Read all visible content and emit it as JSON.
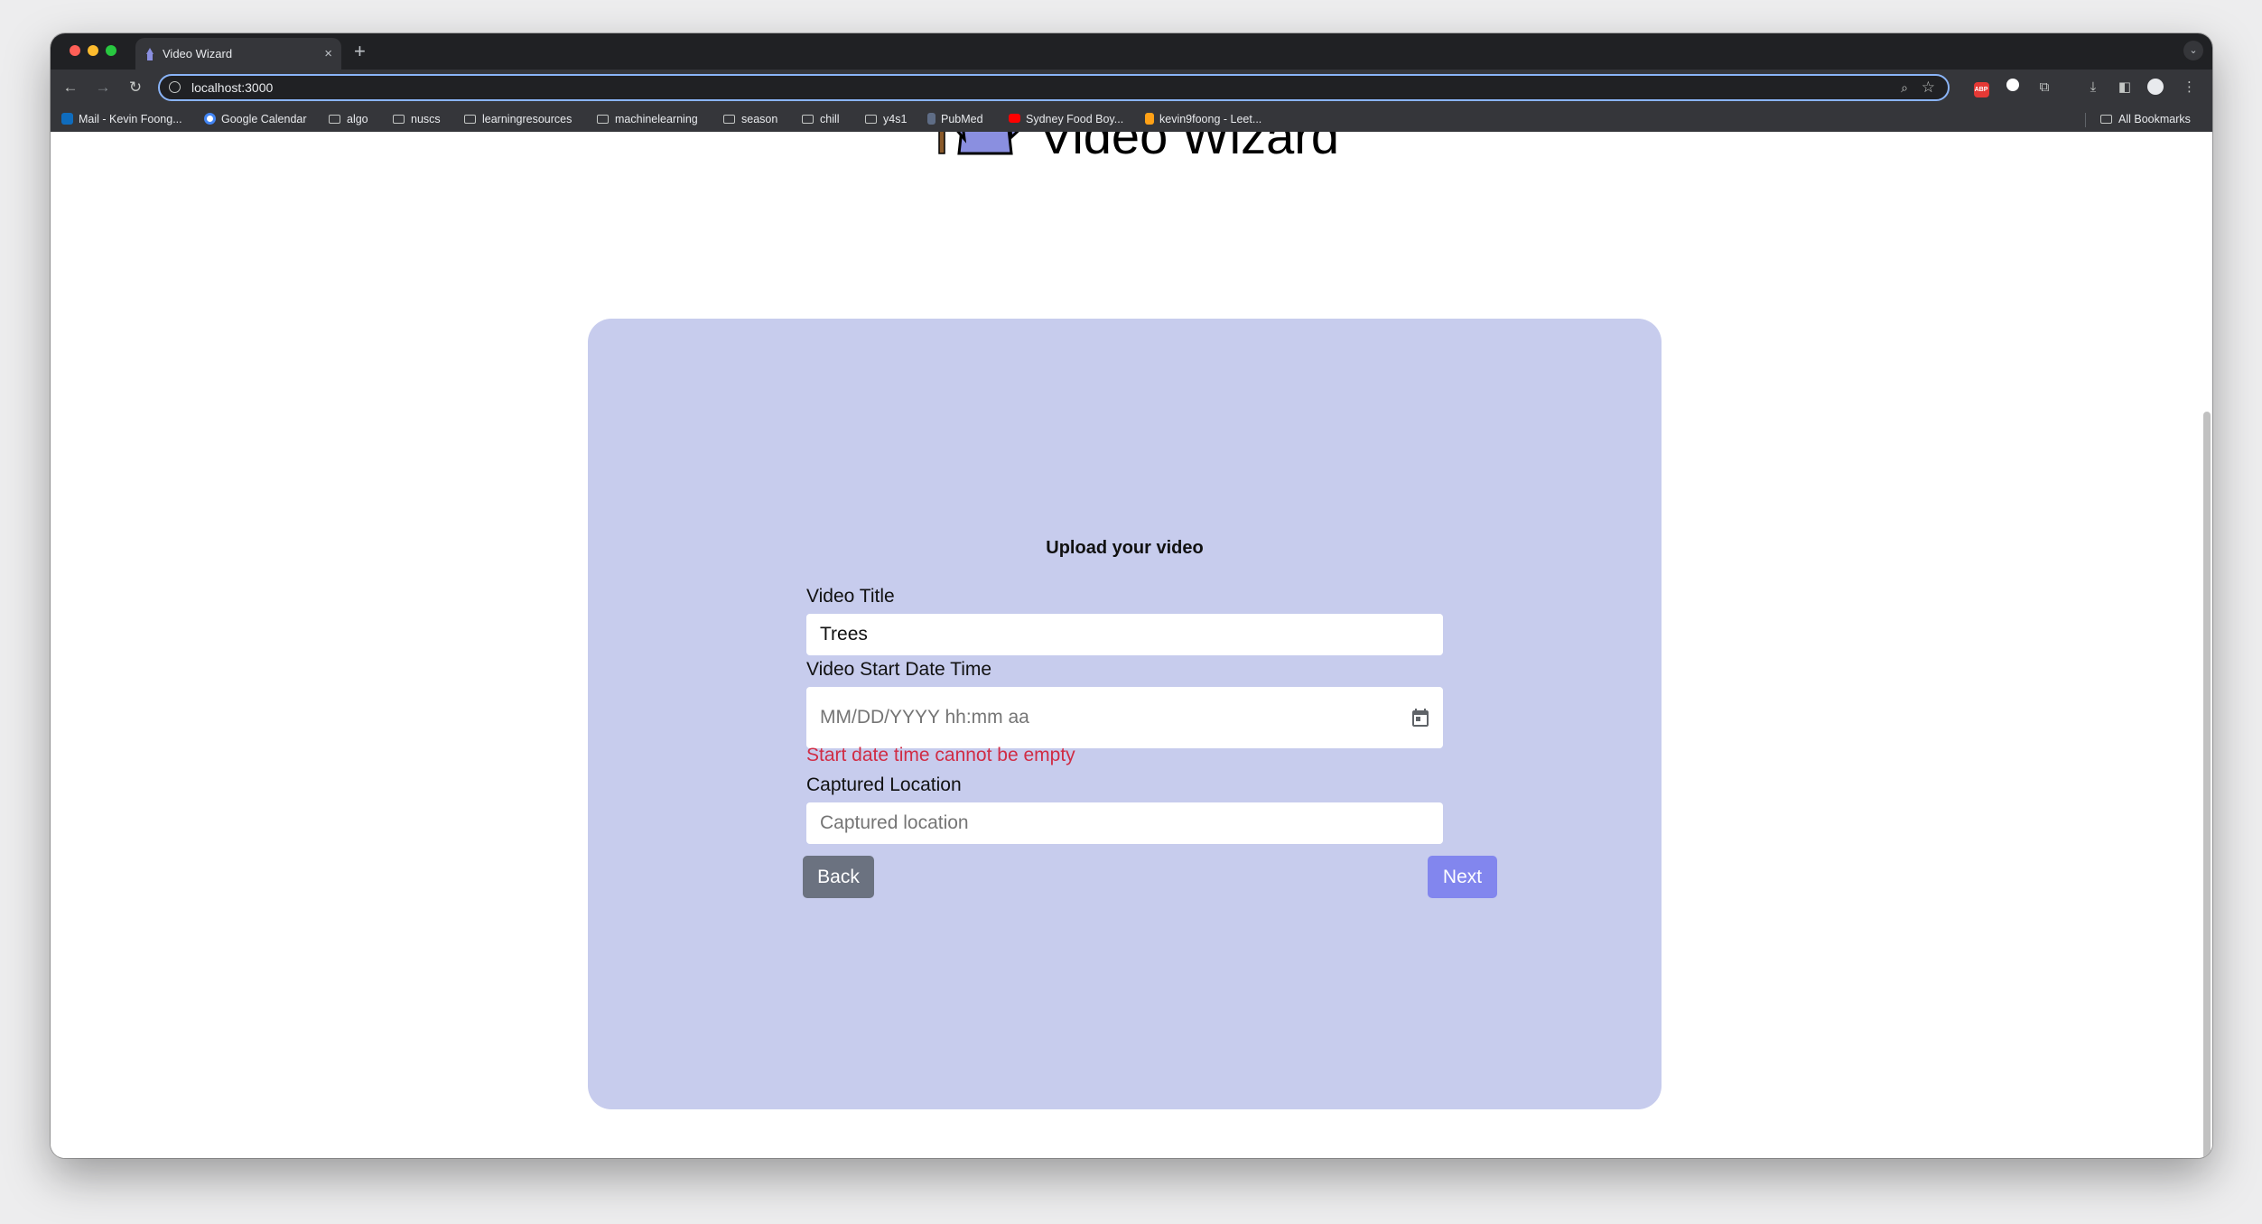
{
  "browser": {
    "tab_title": "Video Wizard",
    "new_tab_icon": "+",
    "close_icon": "×",
    "url": "localhost:3000",
    "bookmarks": [
      {
        "label": "Mail - Kevin Foong...",
        "icon": "outlook-icon"
      },
      {
        "label": "Google Calendar",
        "icon": "google-icon"
      },
      {
        "label": "algo",
        "icon": "folder-icon"
      },
      {
        "label": "nuscs",
        "icon": "folder-icon"
      },
      {
        "label": "learningresources",
        "icon": "folder-icon"
      },
      {
        "label": "machinelearning",
        "icon": "folder-icon"
      },
      {
        "label": "season",
        "icon": "folder-icon"
      },
      {
        "label": "chill",
        "icon": "folder-icon"
      },
      {
        "label": "y4s1",
        "icon": "folder-icon"
      },
      {
        "label": "PubMed",
        "icon": "pubmed-icon"
      },
      {
        "label": "Sydney Food Boy...",
        "icon": "youtube-icon"
      },
      {
        "label": "kevin9foong - Leet...",
        "icon": "leetcode-icon"
      }
    ],
    "all_bookmarks": "All Bookmarks",
    "extension_abp": "ABP"
  },
  "app": {
    "title": "Video Wizard"
  },
  "form": {
    "heading": "Upload your video",
    "title_label": "Video Title",
    "title_value": "Trees",
    "datetime_label": "Video Start Date Time",
    "datetime_placeholder": "MM/DD/YYYY hh:mm aa",
    "datetime_error": "Start date time cannot be empty",
    "location_label": "Captured Location",
    "location_placeholder": "Captured location",
    "back_label": "Back",
    "next_label": "Next"
  },
  "colors": {
    "card_bg": "#c7cced",
    "error": "#d02c45",
    "back_button": "#6b7280",
    "next_button": "#8286ee",
    "accent": "#8ab4f8"
  }
}
